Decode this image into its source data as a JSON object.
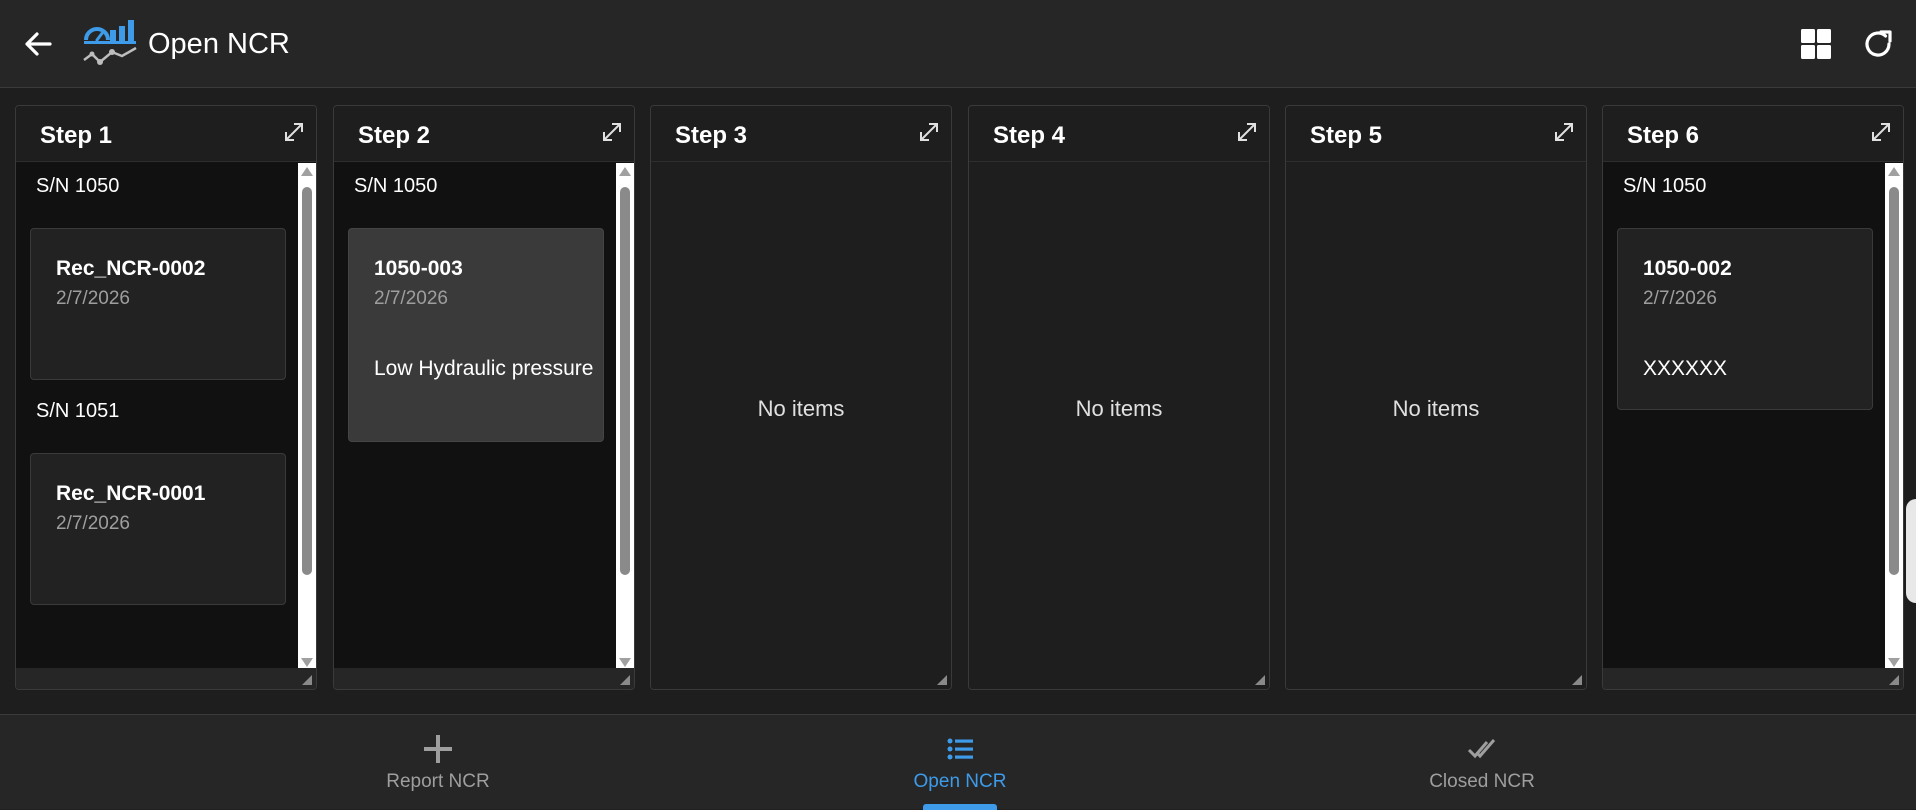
{
  "header": {
    "title": "Open NCR",
    "back_icon": "arrow-left-icon",
    "logo_icon": "gauge-chart-logo-icon",
    "grid_icon": "grid-view-icon",
    "refresh_icon": "refresh-icon"
  },
  "columns": [
    {
      "title": "Step 1",
      "groups": [
        {
          "label": "S/N 1050",
          "cards": [
            {
              "id": "Rec_NCR-0002",
              "date": "2/7/2026",
              "desc": ""
            }
          ]
        },
        {
          "label": "S/N 1051",
          "cards": [
            {
              "id": "Rec_NCR-0001",
              "date": "2/7/2026",
              "desc": ""
            }
          ]
        }
      ]
    },
    {
      "title": "Step 2",
      "groups": [
        {
          "label": "S/N 1050",
          "cards": [
            {
              "id": "1050-003",
              "date": "2/7/2026",
              "desc": "Low Hydraulic pressure"
            }
          ]
        }
      ]
    },
    {
      "title": "Step 3",
      "empty_text": "No items"
    },
    {
      "title": "Step 4",
      "empty_text": "No items"
    },
    {
      "title": "Step 5",
      "empty_text": "No items"
    },
    {
      "title": "Step 6",
      "groups": [
        {
          "label": "S/N 1050",
          "cards": [
            {
              "id": "1050-002",
              "date": "2/7/2026",
              "desc": "XXXXXX"
            }
          ]
        }
      ]
    }
  ],
  "bottom_nav": {
    "items": [
      {
        "label": "Report NCR",
        "icon": "plus-icon",
        "active": false
      },
      {
        "label": "Open NCR",
        "icon": "list-icon",
        "active": true
      },
      {
        "label": "Closed NCR",
        "icon": "double-check-icon",
        "active": false
      }
    ]
  },
  "colors": {
    "accent": "#3d9be9",
    "background": "#1e1e1e",
    "card": "#222222",
    "card_selected": "#3a3a3a"
  }
}
